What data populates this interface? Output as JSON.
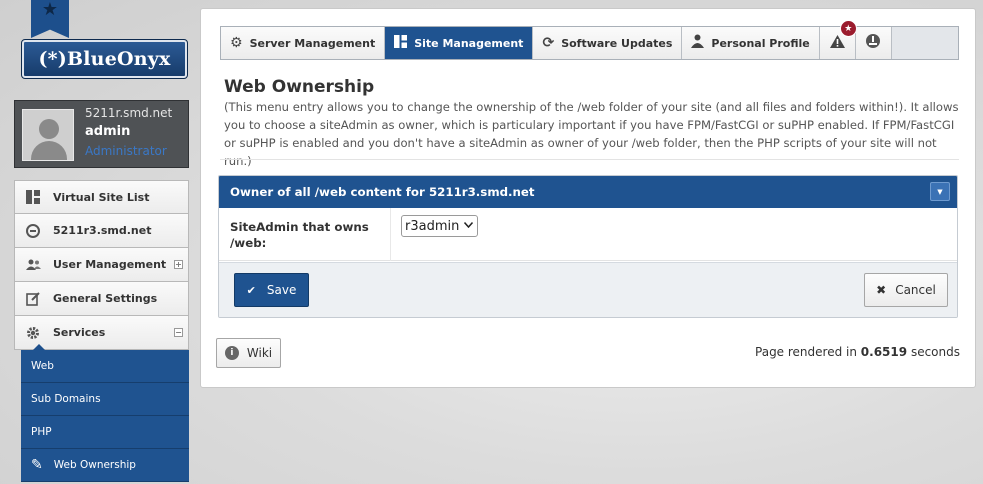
{
  "branding": {
    "logo_text": "(*)BlueOnyx"
  },
  "user": {
    "host": "5211r.smd.net",
    "name": "admin",
    "role": "Administrator"
  },
  "sidebar": {
    "items": [
      {
        "label": "Virtual Site List",
        "icon": "list-icon"
      },
      {
        "label": "5211r3.smd.net",
        "icon": "site-icon"
      },
      {
        "label": "User Management",
        "icon": "users-icon",
        "toggle": "+"
      },
      {
        "label": "General Settings",
        "icon": "edit-icon"
      },
      {
        "label": "Services",
        "icon": "gear-icon",
        "toggle": "−"
      }
    ],
    "sub_items": [
      {
        "label": "Web"
      },
      {
        "label": "Sub Domains"
      },
      {
        "label": "PHP"
      },
      {
        "label": "Web Ownership",
        "icon": "pencil-icon"
      }
    ]
  },
  "tabs": [
    {
      "label": "Server Management",
      "icon": "gear-icon"
    },
    {
      "label": "Site Management",
      "icon": "grid-icon",
      "active": true
    },
    {
      "label": "Software Updates",
      "icon": "refresh-icon"
    },
    {
      "label": "Personal Profile",
      "icon": "person-icon"
    },
    {
      "label": "",
      "icon": "warning-icon",
      "badge": "★"
    },
    {
      "label": "",
      "icon": "logout-icon"
    }
  ],
  "page": {
    "title": "Web Ownership",
    "description": "(This menu entry allows you to change the ownership of the /web folder of your site (and all files and folders within!). It allows you to choose a siteAdmin as owner, which is particulary important if you have FPM/FastCGI or suPHP enabled. If FPM/FastCGI or suPHP is enabled and you don't have a siteAdmin as owner of your /web folder, then the PHP scripts of your site will not run.)"
  },
  "form": {
    "header": "Owner of all /web content for 5211r3.smd.net",
    "field_label": "SiteAdmin that owns /web:",
    "field_value": "r3admin",
    "save_label": "Save",
    "cancel_label": "Cancel"
  },
  "footer": {
    "wiki_label": "Wiki",
    "render_prefix": "Page rendered in",
    "render_time": "0.6519",
    "render_suffix": "seconds"
  },
  "colors": {
    "primary": "#1f5390",
    "badge": "#9b1c2e"
  }
}
